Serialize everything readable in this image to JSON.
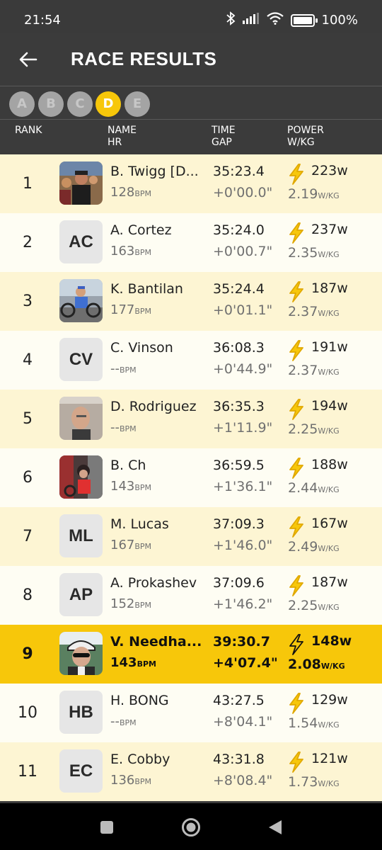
{
  "status": {
    "time": "21:54",
    "battery": "100%"
  },
  "header": {
    "title": "RACE RESULTS"
  },
  "categories": [
    {
      "label": "A",
      "active": false
    },
    {
      "label": "B",
      "active": false
    },
    {
      "label": "C",
      "active": false
    },
    {
      "label": "D",
      "active": true
    },
    {
      "label": "E",
      "active": false
    }
  ],
  "columns": {
    "rank": "RANK",
    "name": "NAME",
    "hr": "HR",
    "time": "TIME",
    "gap": "GAP",
    "power": "POWER",
    "wkg": "W/KG"
  },
  "units": {
    "bpm": "BPM",
    "wkg": "W/KG"
  },
  "rows": [
    {
      "rank": "1",
      "avatar": "photo",
      "name": "B. Twigg [D...",
      "hr": "128",
      "time": "35:23.4",
      "gap": "+0'00.0\"",
      "watts": "223w",
      "wkg": "2.19"
    },
    {
      "rank": "2",
      "avatar": "AC",
      "name": "A. Cortez",
      "hr": "163",
      "time": "35:24.0",
      "gap": "+0'00.7\"",
      "watts": "237w",
      "wkg": "2.35"
    },
    {
      "rank": "3",
      "avatar": "photo",
      "name": "K. Bantilan",
      "hr": "177",
      "time": "35:24.4",
      "gap": "+0'01.1\"",
      "watts": "187w",
      "wkg": "2.37"
    },
    {
      "rank": "4",
      "avatar": "CV",
      "name": "C. Vinson",
      "hr": "--",
      "time": "36:08.3",
      "gap": "+0'44.9\"",
      "watts": "191w",
      "wkg": "2.37"
    },
    {
      "rank": "5",
      "avatar": "photo",
      "name": "D. Rodriguez",
      "hr": "--",
      "time": "36:35.3",
      "gap": "+1'11.9\"",
      "watts": "194w",
      "wkg": "2.25"
    },
    {
      "rank": "6",
      "avatar": "photo",
      "name": "B. Ch",
      "hr": "143",
      "time": "36:59.5",
      "gap": "+1'36.1\"",
      "watts": "188w",
      "wkg": "2.44"
    },
    {
      "rank": "7",
      "avatar": "ML",
      "name": "M. Lucas",
      "hr": "167",
      "time": "37:09.3",
      "gap": "+1'46.0\"",
      "watts": "167w",
      "wkg": "2.49"
    },
    {
      "rank": "8",
      "avatar": "AP",
      "name": "A. Prokashev",
      "hr": "152",
      "time": "37:09.6",
      "gap": "+1'46.2\"",
      "watts": "187w",
      "wkg": "2.25"
    },
    {
      "rank": "9",
      "avatar": "photo",
      "name": "V. Needha...",
      "hr": "143",
      "time": "39:30.7",
      "gap": "+4'07.4\"",
      "watts": "148w",
      "wkg": "2.08",
      "highlight": true
    },
    {
      "rank": "10",
      "avatar": "HB",
      "name": "H. BONG",
      "hr": "--",
      "time": "43:27.5",
      "gap": "+8'04.1\"",
      "watts": "129w",
      "wkg": "1.54"
    },
    {
      "rank": "11",
      "avatar": "EC",
      "name": "E. Cobby",
      "hr": "136",
      "time": "43:31.8",
      "gap": "+8'08.4\"",
      "watts": "121w",
      "wkg": "1.73"
    }
  ],
  "colors": {
    "accent": "#f7c70a",
    "row_odd": "#fdf5d3",
    "row_even": "#fefdf3",
    "header_bg": "#3b3b3b"
  }
}
